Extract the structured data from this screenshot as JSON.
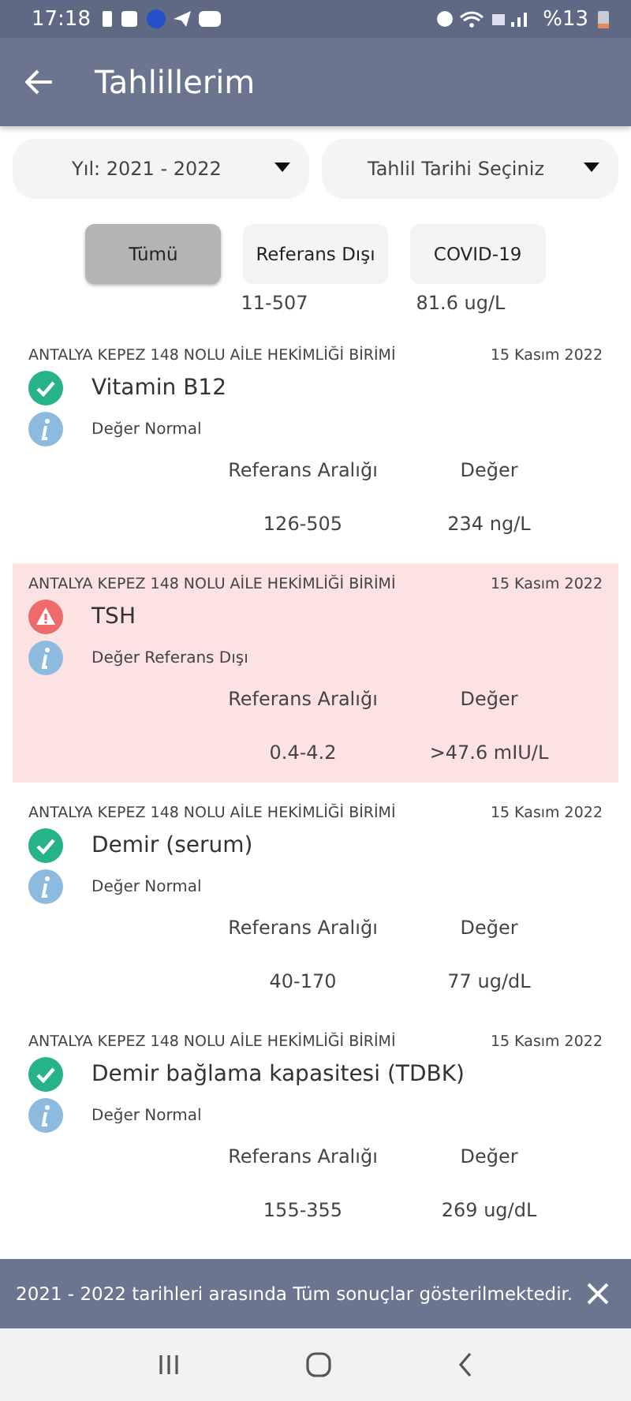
{
  "status_bar": {
    "time": "17:18",
    "battery": "%13"
  },
  "app_bar": {
    "title": "Tahlillerim"
  },
  "dropdowns": [
    {
      "value": "Yıl: 2021 - 2022"
    },
    {
      "value": "Tahlil Tarihi Seçiniz"
    }
  ],
  "filters": [
    {
      "label": "Tümü",
      "selected": true
    },
    {
      "label": "Referans Dışı",
      "selected": false
    },
    {
      "label": "COVID-19",
      "selected": false
    }
  ],
  "partial_row": {
    "range": "11-507",
    "value": "81.6 ug/L"
  },
  "results": [
    {
      "clinic": "ANTALYA KEPEZ 148 NOLU AİLE HEKİMLİĞİ BİRİMİ",
      "date": "15 Kasım 2022",
      "name": "Vitamin B12",
      "status": "Değer Normal",
      "kind": "normal",
      "range_label": "Referans Aralığı",
      "value_label": "Değer",
      "range": "126-505",
      "value": "234 ng/L"
    },
    {
      "clinic": "ANTALYA KEPEZ 148 NOLU AİLE HEKİMLİĞİ BİRİMİ",
      "date": "15 Kasım 2022",
      "name": "TSH",
      "status": "Değer Referans Dışı",
      "kind": "abnormal",
      "range_label": "Referans Aralığı",
      "value_label": "Değer",
      "range": "0.4-4.2",
      "value": ">47.6 mIU/L"
    },
    {
      "clinic": "ANTALYA KEPEZ 148 NOLU AİLE HEKİMLİĞİ BİRİMİ",
      "date": "15 Kasım 2022",
      "name": "Demir (serum)",
      "status": "Değer Normal",
      "kind": "normal",
      "range_label": "Referans Aralığı",
      "value_label": "Değer",
      "range": "40-170",
      "value": "77 ug/dL"
    },
    {
      "clinic": "ANTALYA KEPEZ 148 NOLU AİLE HEKİMLİĞİ BİRİMİ",
      "date": "15 Kasım 2022",
      "name": "Demir bağlama kapasitesi (TDBK)",
      "status": "Değer Normal",
      "kind": "normal",
      "range_label": "Referans Aralığı",
      "value_label": "Değer",
      "range": "155-355",
      "value": "269 ug/dL"
    }
  ],
  "snackbar": {
    "message": "2021 - 2022 tarihleri arasında Tüm sonuçlar gösterilmektedir."
  }
}
